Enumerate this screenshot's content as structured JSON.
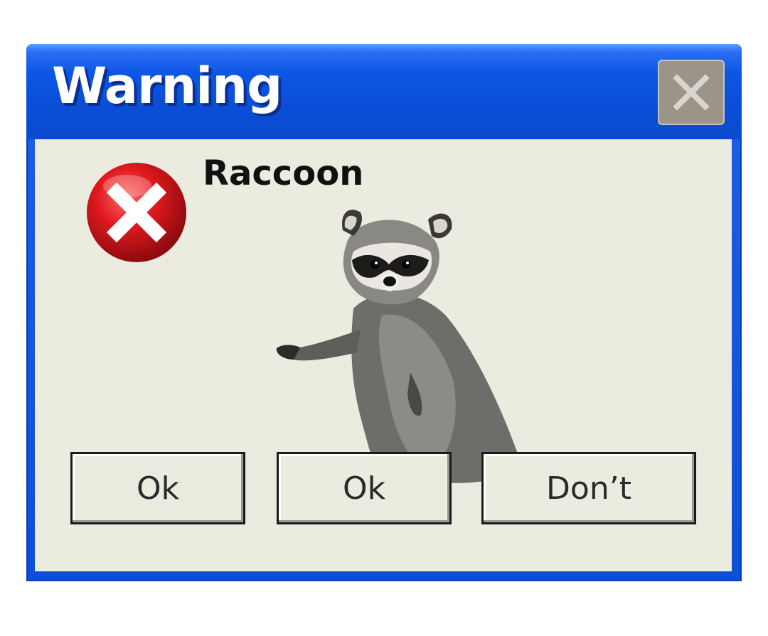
{
  "window": {
    "title": "Warning",
    "message": "Raccoon"
  },
  "icons": {
    "close": "close-icon",
    "error": "error-icon",
    "image": "raccoon-image"
  },
  "buttons": [
    {
      "label": "Ok"
    },
    {
      "label": "Ok"
    },
    {
      "label": "Don’t"
    }
  ],
  "colors": {
    "titlebar": "#0a4fd9",
    "client": "#ecebdf",
    "error_red": "#d1121a"
  }
}
